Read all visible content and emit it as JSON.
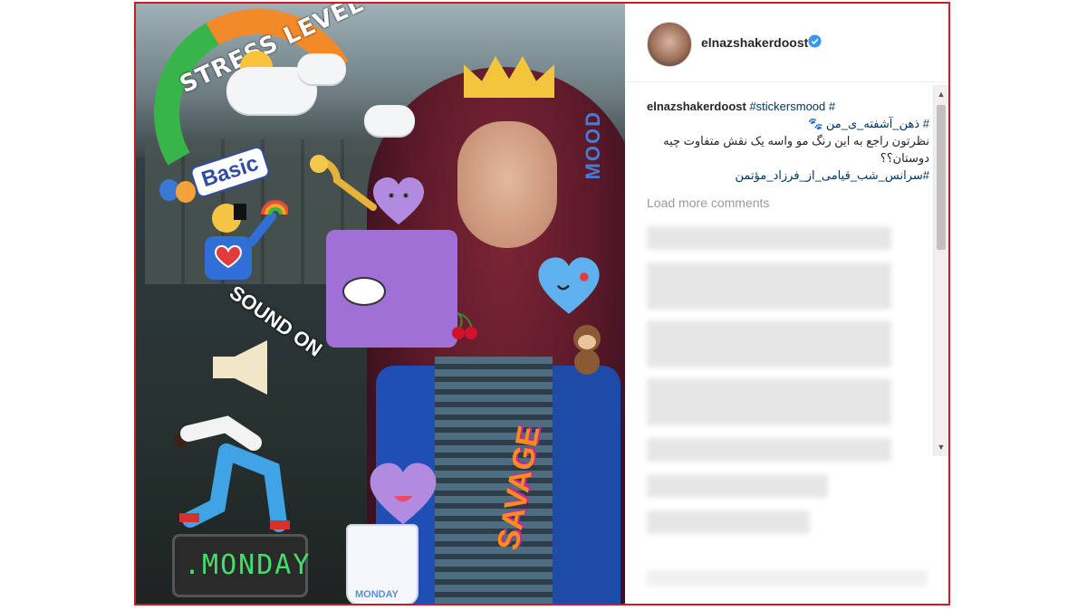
{
  "post": {
    "username": "elnazshakerdoost",
    "caption_user": "elnazshakerdoost",
    "caption_tags": "#stickersmood #",
    "caption_line1": "# ذهن_آشفته_ی_من 🐾",
    "caption_line2": "نظرتون راجع به این رنگ مو واسه یک نقش متفاوت چیه",
    "caption_line3": "دوستان؟؟",
    "caption_line4": "#سرانس_شب_قیامی_از_فرزاد_مؤتمن",
    "load_more": "Load more comments"
  },
  "photo": {
    "stickers": {
      "stress_level": "STRESS LEVEL",
      "basic": "Basic",
      "sound_on": "SOUND ON",
      "savage": "SAVAGE",
      "mood": "MOOD",
      "monday_clock": ".MONDAY",
      "mug_label": "MONDAY"
    }
  },
  "colors": {
    "frame_border": "#c81d25",
    "verified_badge": "#3897f0",
    "hashtag": "#003569"
  }
}
